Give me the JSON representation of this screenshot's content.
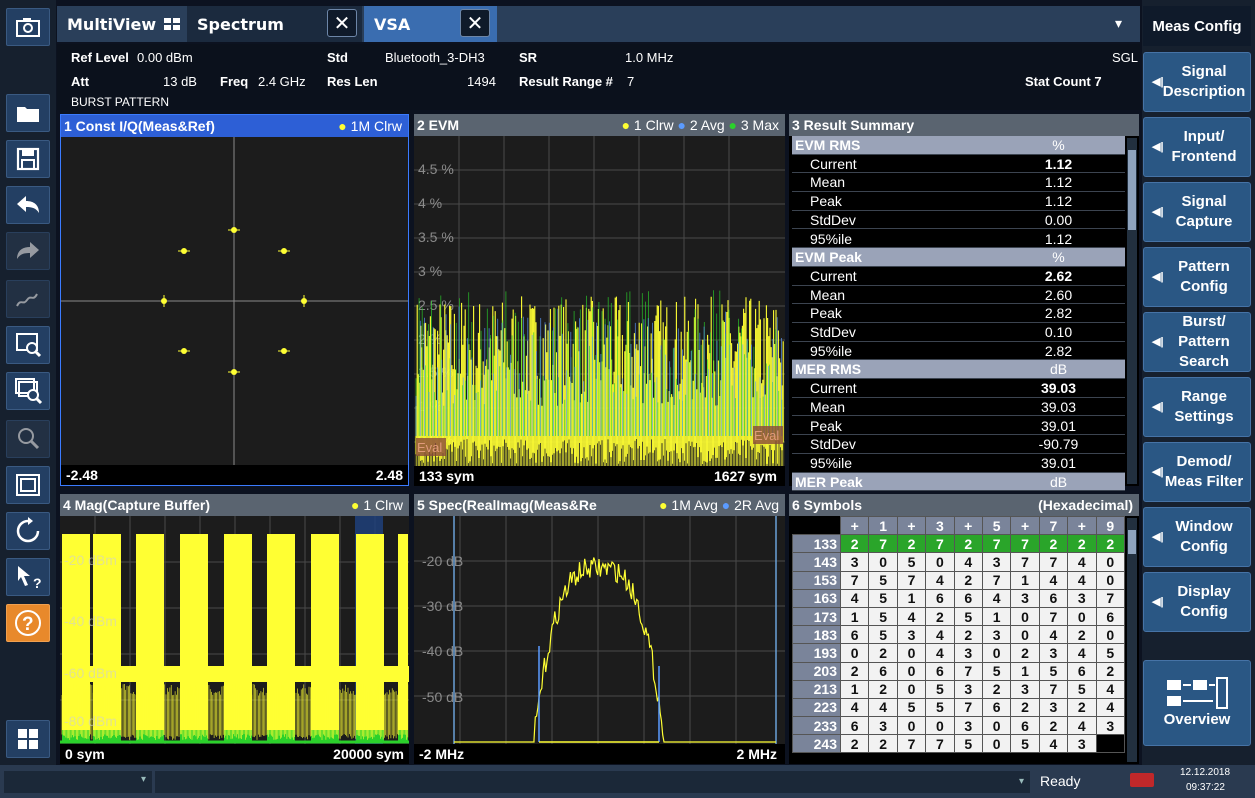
{
  "tabs": {
    "multiview": "MultiView",
    "spectrum": "Spectrum",
    "vsa": "VSA",
    "close_glyph": "✕",
    "dropdown_glyph": "▾"
  },
  "info": {
    "ref_level_label": "Ref Level",
    "ref_level_value": "0.00 dBm",
    "att_label": "Att",
    "att_value": "13 dB",
    "freq_label": "Freq",
    "freq_value": "2.4 GHz",
    "std_label": "Std",
    "std_value": "Bluetooth_3-DH3",
    "res_len_label": "Res Len",
    "res_len_value": "1494",
    "sr_label": "SR",
    "sr_value": "1.0 MHz",
    "result_range_label": "Result Range #",
    "result_range_value": "7",
    "sgl": "SGL",
    "stat_count": "Stat Count 7",
    "burst_pattern": "BURST PATTERN"
  },
  "panel1": {
    "title": "1 Const I/Q(Meas&Ref)",
    "legend": "1M Clrw",
    "x_min": "-2.48",
    "x_max": "2.48"
  },
  "panel2": {
    "title": "2 EVM",
    "legend1": "1 Clrw",
    "legend2": "2 Avg",
    "legend3": "3 Max",
    "eval_left": "Eval",
    "eval_right": "Eval",
    "x_min": "133 sym",
    "x_max": "1627 sym"
  },
  "panel3": {
    "title": "3 Result Summary",
    "sections": [
      {
        "name": "EVM RMS",
        "unit": "%",
        "rows": [
          [
            "Current",
            "1.12"
          ],
          [
            "Mean",
            "1.12"
          ],
          [
            "Peak",
            "1.12"
          ],
          [
            "StdDev",
            "0.00"
          ],
          [
            "95%ile",
            "1.12"
          ]
        ]
      },
      {
        "name": "EVM Peak",
        "unit": "%",
        "rows": [
          [
            "Current",
            "2.62"
          ],
          [
            "Mean",
            "2.60"
          ],
          [
            "Peak",
            "2.82"
          ],
          [
            "StdDev",
            "0.10"
          ],
          [
            "95%ile",
            "2.82"
          ]
        ]
      },
      {
        "name": "MER RMS",
        "unit": "dB",
        "rows": [
          [
            "Current",
            "39.03"
          ],
          [
            "Mean",
            "39.03"
          ],
          [
            "Peak",
            "39.01"
          ],
          [
            "StdDev",
            "-90.79"
          ],
          [
            "95%ile",
            "39.01"
          ]
        ]
      },
      {
        "name": "MER Peak",
        "unit": "dB",
        "rows": []
      }
    ]
  },
  "panel4": {
    "title": "4 Mag(Capture Buffer)",
    "legend": "1 Clrw",
    "x_min": "0 sym",
    "x_max": "20000 sym"
  },
  "panel5": {
    "title": "5 Spec(RealImag(Meas&Re",
    "legend1": "1M Avg",
    "legend2": "2R Avg",
    "x_min": "-2 MHz",
    "x_max": "2 MHz"
  },
  "panel6": {
    "title": "6 Symbols",
    "format": "(Hexadecimal)",
    "header": [
      "+",
      "1",
      "+",
      "3",
      "+",
      "5",
      "+",
      "7",
      "+",
      "9"
    ],
    "rows": [
      {
        "addr": "133",
        "vals": [
          "2",
          "7",
          "2",
          "7",
          "2",
          "7",
          "7",
          "2",
          "2",
          "2"
        ]
      },
      {
        "addr": "143",
        "vals": [
          "3",
          "0",
          "5",
          "0",
          "4",
          "3",
          "7",
          "7",
          "4",
          "0"
        ]
      },
      {
        "addr": "153",
        "vals": [
          "7",
          "5",
          "7",
          "4",
          "2",
          "7",
          "1",
          "4",
          "4",
          "0"
        ]
      },
      {
        "addr": "163",
        "vals": [
          "4",
          "5",
          "1",
          "6",
          "6",
          "4",
          "3",
          "6",
          "3",
          "7"
        ]
      },
      {
        "addr": "173",
        "vals": [
          "1",
          "5",
          "4",
          "2",
          "5",
          "1",
          "0",
          "7",
          "0",
          "6"
        ]
      },
      {
        "addr": "183",
        "vals": [
          "6",
          "5",
          "3",
          "4",
          "2",
          "3",
          "0",
          "4",
          "2",
          "0"
        ]
      },
      {
        "addr": "193",
        "vals": [
          "0",
          "2",
          "0",
          "4",
          "3",
          "0",
          "2",
          "3",
          "4",
          "5"
        ]
      },
      {
        "addr": "203",
        "vals": [
          "2",
          "6",
          "0",
          "6",
          "7",
          "5",
          "1",
          "5",
          "6",
          "2"
        ]
      },
      {
        "addr": "213",
        "vals": [
          "1",
          "2",
          "0",
          "5",
          "3",
          "2",
          "3",
          "7",
          "5",
          "4"
        ]
      },
      {
        "addr": "223",
        "vals": [
          "4",
          "4",
          "5",
          "5",
          "7",
          "6",
          "2",
          "3",
          "2",
          "4"
        ]
      },
      {
        "addr": "233",
        "vals": [
          "6",
          "3",
          "0",
          "0",
          "3",
          "0",
          "6",
          "2",
          "4",
          "3"
        ]
      },
      {
        "addr": "243",
        "vals": [
          "2",
          "2",
          "7",
          "7",
          "5",
          "0",
          "5",
          "4",
          "3",
          ""
        ]
      }
    ]
  },
  "softkeys": {
    "header": "Meas Config",
    "items": [
      [
        "Signal",
        "Description"
      ],
      [
        "Input/",
        "Frontend"
      ],
      [
        "Signal",
        "Capture"
      ],
      [
        "Pattern",
        "Config"
      ],
      [
        "Burst/",
        "Pattern",
        "Search"
      ],
      [
        "Range",
        "Settings"
      ],
      [
        "Demod/",
        "Meas Filter"
      ],
      [
        "Window",
        "Config"
      ],
      [
        "Display",
        "Config"
      ]
    ],
    "overview": "Overview"
  },
  "status": {
    "ready": "Ready",
    "date": "12.12.2018",
    "time": "09:37:22"
  },
  "colors": {
    "trace_yellow": "#ffff33",
    "trace_blue": "#5b9bff",
    "trace_green": "#2bd12b",
    "selected_title": "#2d5fd6",
    "help_orange": "#e8892b"
  }
}
